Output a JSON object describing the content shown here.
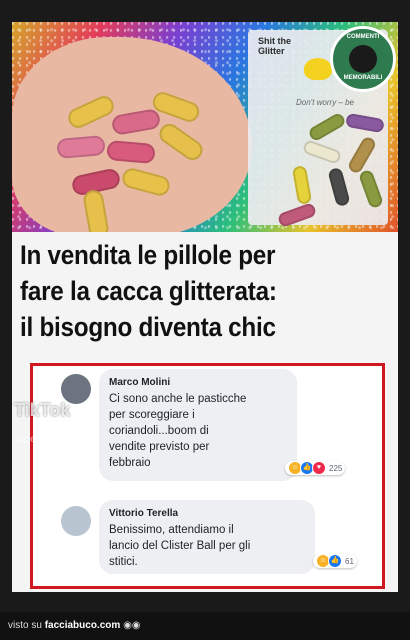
{
  "image": {
    "packet_title": "Shit the Glitter",
    "packet_tagline": "Don't worry – be",
    "seal_top": "COMMENTI",
    "seal_bottom": "MEMORABILI"
  },
  "headline": {
    "line1": "In vendita le pillole per",
    "line2": "fare la cacca glitterata:",
    "line3": "il bisogno diventa chic"
  },
  "comments": [
    {
      "author": "Marco Molini",
      "lines": [
        "Ci sono anche le pasticche",
        "per scoreggiare i",
        "coriandoli...boom di",
        "vendite previsto per",
        "febbraio"
      ],
      "reaction_count": "225"
    },
    {
      "author": "Vittorio Terella",
      "lines": [
        "Benissimo, attendiamo il",
        "lancio del Clister Ball per gli",
        "stitici."
      ],
      "reaction_count": "61"
    }
  ],
  "watermark": {
    "app": "TikTok",
    "user": "super_news7"
  },
  "footer": {
    "prefix": "visto su",
    "brand": "facciabuco.com"
  },
  "colors": {
    "border_red": "#d01820",
    "reaction_blue": "#1877f2",
    "reaction_red": "#f02849",
    "reaction_yellow": "#f7b125"
  }
}
